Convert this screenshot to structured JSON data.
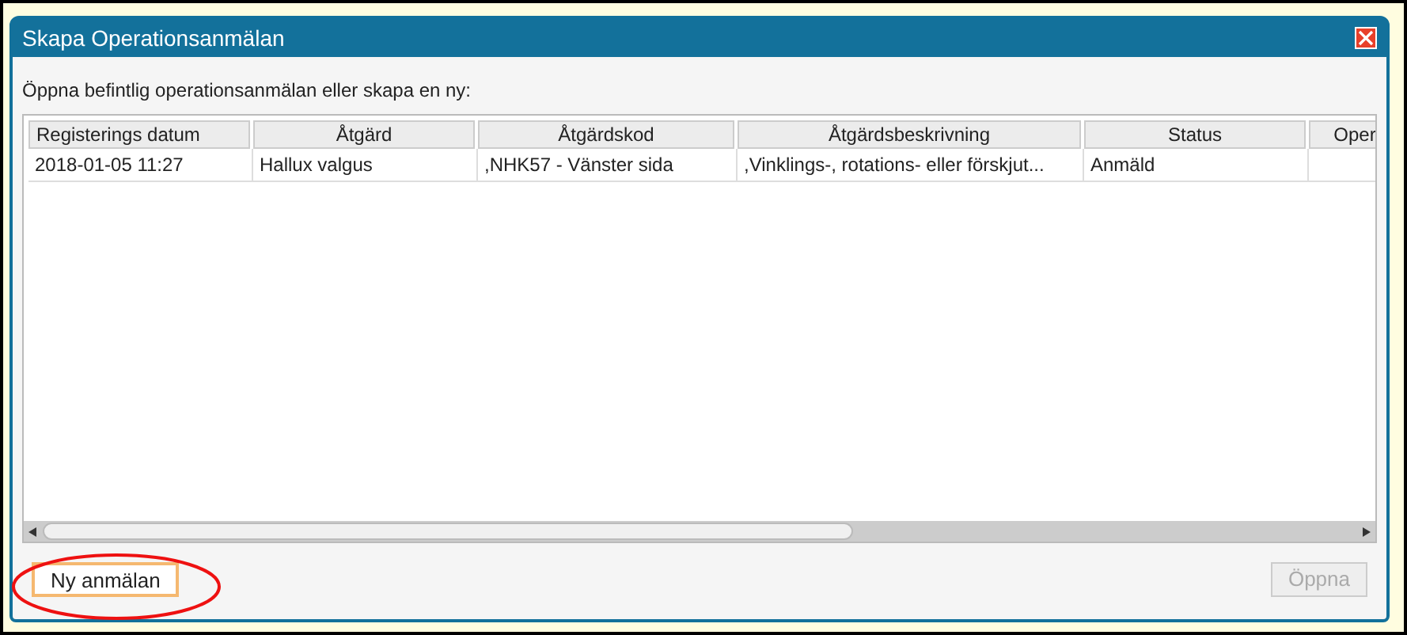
{
  "window": {
    "title": "Skapa Operationsanmälan"
  },
  "prompt": "Öppna befintlig operationsanmälan eller skapa en ny:",
  "table": {
    "columns": [
      "Registerings datum",
      "Åtgärd",
      "Åtgärdskod",
      "Åtgärdsbeskrivning",
      "Status",
      "Oper"
    ],
    "rows": [
      {
        "selected": false,
        "cells": [
          "2018-01-05 11:27",
          "Hallux valgus",
          ",NHK57 - Vänster sida",
          ",Vinklings-, rotations- eller förskjut...",
          "Anmäld",
          ""
        ]
      }
    ]
  },
  "buttons": [
    {
      "label": "Ny anmälan",
      "disabled": false,
      "highlighted": true
    },
    {
      "label": "Öppna",
      "disabled": true,
      "highlighted": false
    }
  ]
}
